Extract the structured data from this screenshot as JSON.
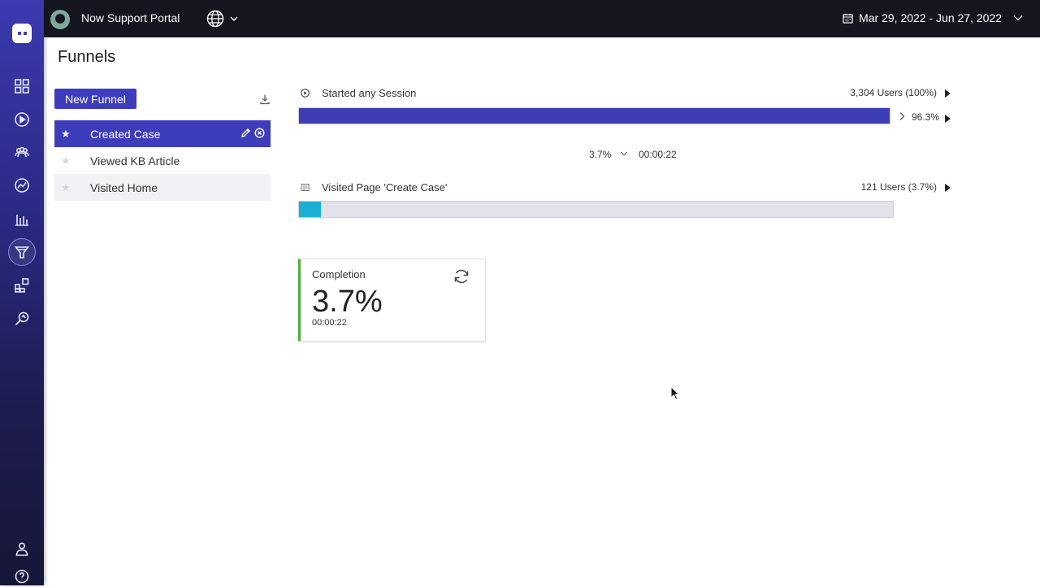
{
  "topbar": {
    "portal_name": "Now Support Portal",
    "date_range": "Mar 29, 2022 - Jun 27, 2022"
  },
  "page": {
    "title": "Funnels"
  },
  "funnels": {
    "new_label": "New Funnel",
    "items": [
      {
        "label": "Created Case",
        "selected": true
      },
      {
        "label": "Viewed KB Article",
        "selected": false
      },
      {
        "label": "Visited Home",
        "selected": false
      }
    ]
  },
  "steps": [
    {
      "label": "Started any Session",
      "count": "3,304 Users (100%)",
      "fill_percent": 100,
      "fill_color": "#3d3db5",
      "drop_percent": "96.3%"
    },
    {
      "label": "Visited Page 'Create Case'",
      "count": "121 Users (3.7%)",
      "fill_percent": 3.7,
      "fill_color": "#1ab0d6"
    }
  ],
  "conversion": {
    "percent": "3.7%",
    "time": "00:00:22"
  },
  "completion": {
    "title": "Completion",
    "value": "3.7%",
    "time": "00:00:22",
    "accent": "#4caf3a"
  },
  "colors": {
    "rail_top": "#3b3ab0",
    "rail_bottom": "#161638",
    "topbar": "#15151f",
    "primary": "#3d3dbc"
  }
}
